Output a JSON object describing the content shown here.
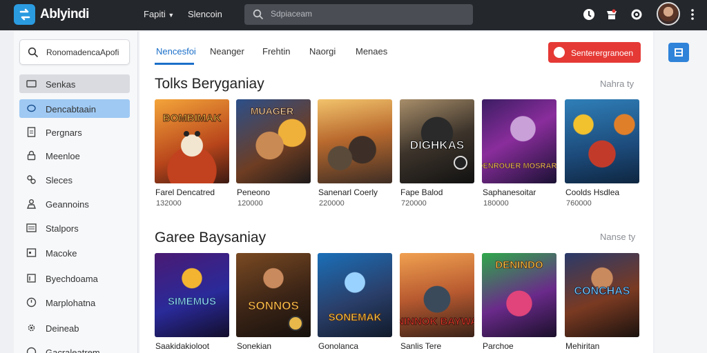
{
  "app": {
    "name": "Ablyindi"
  },
  "topnav": {
    "links": [
      "Fapiti",
      "Slencoin"
    ],
    "search_placeholder": "Sdpiaceam"
  },
  "sidebar": {
    "search_placeholder": "RonomadencaApofi",
    "items": [
      {
        "label": "Senkas",
        "icon": "window-icon"
      },
      {
        "label": "Dencabtaain",
        "icon": "chat-bubble-icon"
      },
      {
        "label": "Pergnars",
        "icon": "document-icon"
      },
      {
        "label": "Meenloe",
        "icon": "lock-icon"
      },
      {
        "label": "Sleces",
        "icon": "link-icon"
      },
      {
        "label": "Geannoins",
        "icon": "person-icon"
      },
      {
        "label": "Stalpors",
        "icon": "list-icon"
      },
      {
        "label": "Macoke",
        "icon": "calendar-icon"
      },
      {
        "label": "Byechdoama",
        "icon": "flag-icon"
      },
      {
        "label": "Marplohatna",
        "icon": "clock-icon"
      },
      {
        "label": "Deineab",
        "icon": "gear-icon"
      },
      {
        "label": "Gacraleatrem",
        "icon": "circle-icon"
      }
    ]
  },
  "tabs": [
    {
      "label": "Nencesfoi"
    },
    {
      "label": "Neanger"
    },
    {
      "label": "Frehtin"
    },
    {
      "label": "Naorgi"
    },
    {
      "label": "Menaes"
    }
  ],
  "action_button": {
    "label": "Senterergranoen"
  },
  "sections": [
    {
      "title": "Tolks Beryganiay",
      "view_all": "Nahra ty",
      "items": [
        {
          "name": "Farel Dencatred",
          "count": "132000"
        },
        {
          "name": "Peneono",
          "count": "120000"
        },
        {
          "name": "Sanenarl Coerly",
          "count": "220000"
        },
        {
          "name": "Fape Balod",
          "count": "720000"
        },
        {
          "name": "Saphanesoitar",
          "count": "180000"
        },
        {
          "name": "Coolds Hsdlea",
          "count": "760000"
        }
      ]
    },
    {
      "title": "Garee Baysaniay",
      "view_all": "Nanse ty",
      "items": [
        {
          "name": "Saakidakioloot",
          "count": ""
        },
        {
          "name": "Sonekian",
          "count": ""
        },
        {
          "name": "Gonolanca",
          "count": ""
        },
        {
          "name": "Sanlis Tere",
          "count": ""
        },
        {
          "name": "Parchoe",
          "count": ""
        },
        {
          "name": "Mehiritan",
          "count": ""
        }
      ]
    }
  ],
  "art_text": [
    "BOMBIMAK",
    "MUAGER",
    "",
    "DIGHKAS",
    "BOENROUER MOSRARES",
    "",
    "SIMEMUS",
    "SONNOS",
    "SONEMAK",
    "NINNOK BAYWA",
    "DENINDO",
    "CONCHAS"
  ]
}
